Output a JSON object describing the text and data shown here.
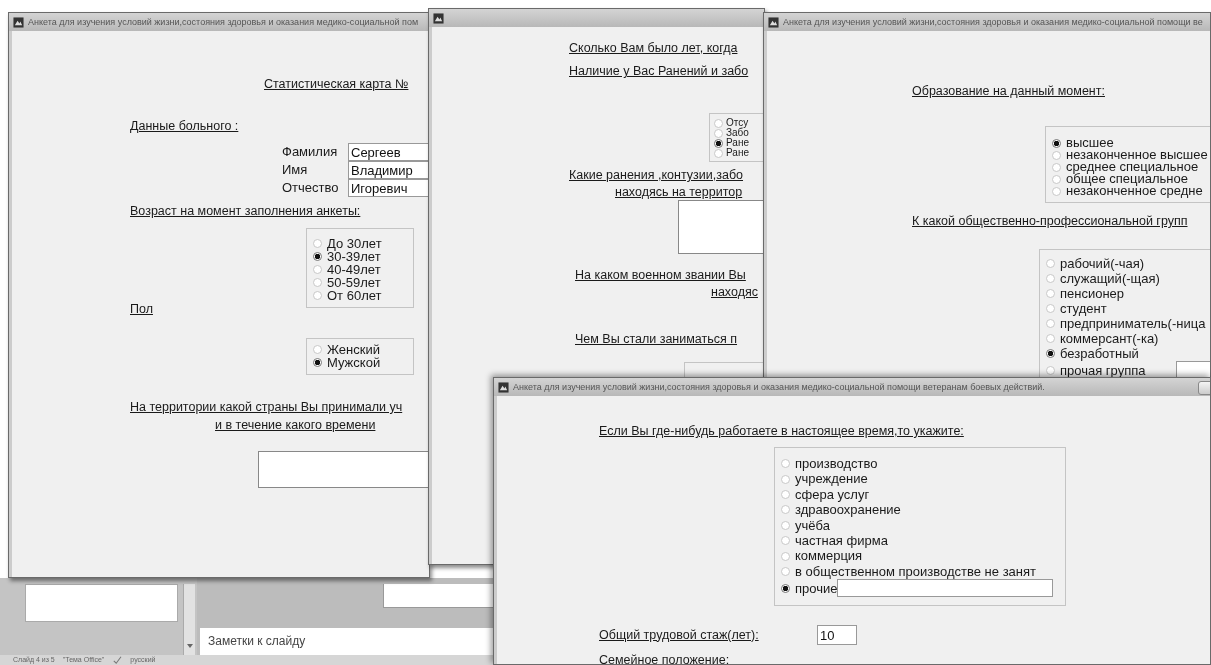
{
  "windows": [
    {
      "title": "Анкета для изучения условий жизни,состояния здоровья и оказания медико-социальной пом",
      "items": [
        {
          "kind": "heading",
          "text": "Статистическая карта №"
        },
        {
          "kind": "heading",
          "text": "Данные больного :"
        },
        {
          "kind": "fields",
          "rows": [
            {
              "label": "Фамилия",
              "value": "Сергеев"
            },
            {
              "label": "Имя",
              "value": "Владимир"
            },
            {
              "label": "Отчество",
              "value": "Игоревич"
            }
          ]
        },
        {
          "kind": "heading",
          "text": "Возраст на момент заполнения анкеты:"
        },
        {
          "kind": "radio_group",
          "options": [
            {
              "label": "До 30лет",
              "selected": false
            },
            {
              "label": "30-39лет",
              "selected": true
            },
            {
              "label": "40-49лет",
              "selected": false
            },
            {
              "label": "50-59лет",
              "selected": false
            },
            {
              "label": "От 60лет",
              "selected": false
            }
          ]
        },
        {
          "kind": "heading",
          "text": "Пол"
        },
        {
          "kind": "radio_group",
          "options": [
            {
              "label": "Женский",
              "selected": false
            },
            {
              "label": "Мужской",
              "selected": true
            }
          ]
        },
        {
          "kind": "heading",
          "text": "На территории какой страны Вы принимали уч"
        },
        {
          "kind": "heading",
          "text": "и в течение какого времени"
        },
        {
          "kind": "textbox"
        }
      ]
    },
    {
      "items": [
        {
          "kind": "heading",
          "text": "Сколько Вам было лет, когда"
        },
        {
          "kind": "heading",
          "text": "Наличие у Вас Ранений и забо"
        },
        {
          "kind": "radio_group",
          "options": [
            {
              "label": "Отсу",
              "selected": false
            },
            {
              "label": "Забо",
              "selected": false
            },
            {
              "label": "Ране",
              "selected": true
            },
            {
              "label": "Ране",
              "selected": false
            }
          ]
        },
        {
          "kind": "heading",
          "text": "Какие ранения ,контузии,забо"
        },
        {
          "kind": "heading",
          "text": "находясь на территор"
        },
        {
          "kind": "textbox"
        },
        {
          "kind": "heading",
          "text": "На каком военном звании Вы"
        },
        {
          "kind": "heading",
          "text": "находяс"
        },
        {
          "kind": "heading",
          "text": "Чем Вы стали заниматься п"
        },
        {
          "kind": "group_box"
        }
      ]
    },
    {
      "title": "Анкета для изучения условий жизни,состояния здоровья и оказания медико-социальной помощи ве",
      "items": [
        {
          "kind": "heading",
          "text": "Образование на данный момент:"
        },
        {
          "kind": "radio_group",
          "options": [
            {
              "label": "высшее",
              "selected": true
            },
            {
              "label": "незаконченное высшее",
              "selected": false
            },
            {
              "label": "среднее специальное",
              "selected": false
            },
            {
              "label": "общее специальное",
              "selected": false
            },
            {
              "label": "незаконченное средне",
              "selected": false
            }
          ]
        },
        {
          "kind": "heading",
          "text": "К какой общественно-профессиональной групп"
        },
        {
          "kind": "radio_group",
          "options": [
            {
              "label": "рабочий(-чая)",
              "selected": false
            },
            {
              "label": "служащий(-щая)",
              "selected": false
            },
            {
              "label": "пенсионер",
              "selected": false
            },
            {
              "label": "студент",
              "selected": false
            },
            {
              "label": "предприниматель(-ница",
              "selected": false
            },
            {
              "label": "коммерсант(-ка)",
              "selected": false
            },
            {
              "label": "безработный",
              "selected": true
            },
            {
              "label": "прочая группа",
              "selected": false,
              "has_field": true
            }
          ]
        }
      ]
    },
    {
      "title": "Анкета для изучения условий жизни,состояния здоровья и оказания медико-социальной помощи ветеранам боевых действий.",
      "minimize_button": true,
      "items": [
        {
          "kind": "heading",
          "text": "Если Вы где-нибудь работаете в настоящее время,то укажите:"
        },
        {
          "kind": "radio_group",
          "options": [
            {
              "label": "производство",
              "selected": false
            },
            {
              "label": "учреждение",
              "selected": false
            },
            {
              "label": "сфера услуг",
              "selected": false
            },
            {
              "label": "здравоохранение",
              "selected": false
            },
            {
              "label": "учёба",
              "selected": false
            },
            {
              "label": "частная фирма",
              "selected": false
            },
            {
              "label": "коммерция",
              "selected": false
            },
            {
              "label": "в общественном производстве не занят",
              "selected": false
            },
            {
              "label": "прочие",
              "selected": true,
              "has_field": true
            }
          ]
        },
        {
          "kind": "labeled_field",
          "label": "Общий трудовой стаж(лет):",
          "value": "10"
        },
        {
          "kind": "heading",
          "text": "Семейное положение:"
        }
      ]
    }
  ],
  "powerpoint": {
    "notes": "Заметки к слайду",
    "status_bar": [
      "Слайд 4 из 5",
      "\"Тема Office\"",
      "русский"
    ]
  }
}
